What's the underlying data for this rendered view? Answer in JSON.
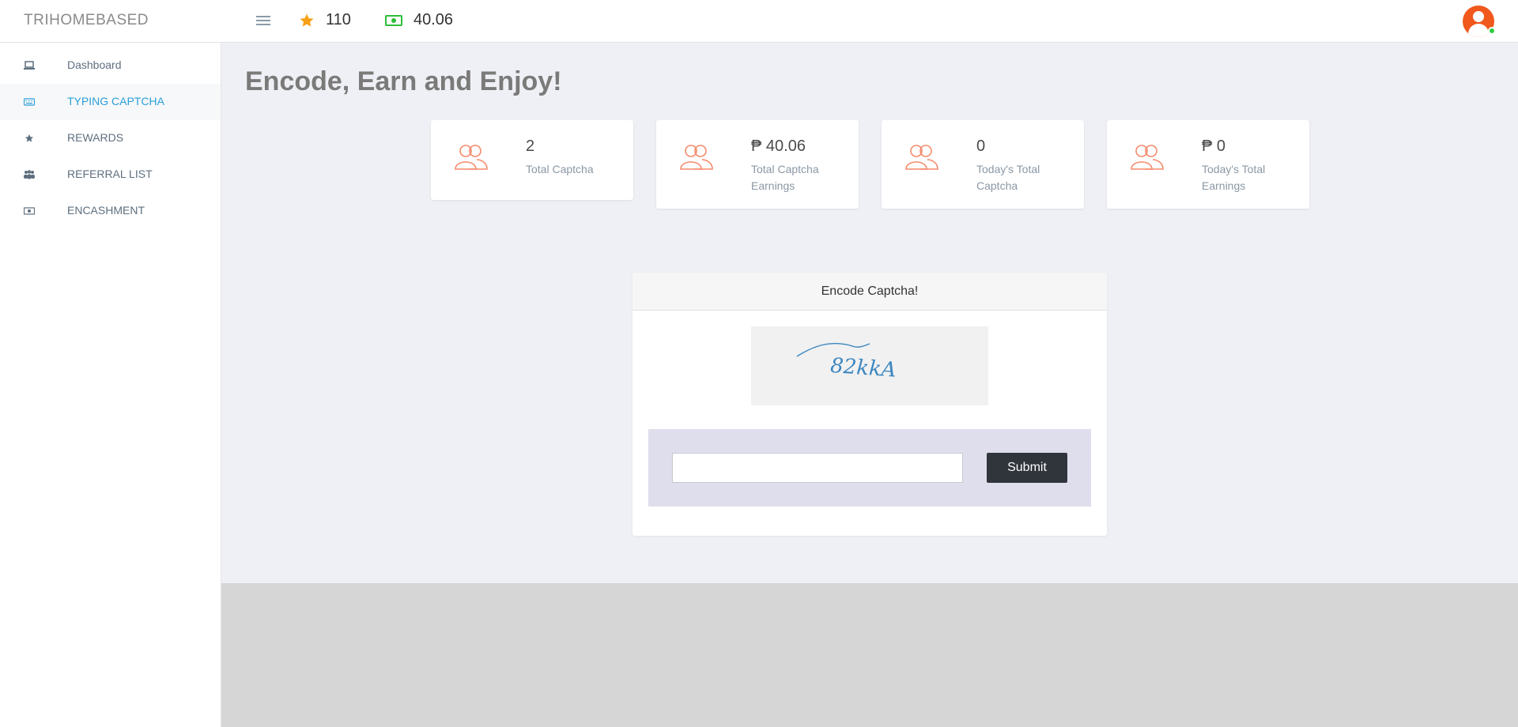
{
  "app": {
    "brand": "TRIHOMEBASED"
  },
  "header": {
    "points_value": "110",
    "balance_value": "40.06",
    "accent_star": "#f7a014",
    "accent_money": "#2ebd3a"
  },
  "sidebar": {
    "items": [
      {
        "label": "Dashboard",
        "icon": "laptop-icon"
      },
      {
        "label": "TYPING CAPTCHA",
        "icon": "keyboard-icon",
        "active": true
      },
      {
        "label": "REWARDS",
        "icon": "star-icon"
      },
      {
        "label": "REFERRAL LIST",
        "icon": "users-icon"
      },
      {
        "label": "ENCASHMENT",
        "icon": "money-icon"
      }
    ]
  },
  "main": {
    "title": "Encode, Earn and Enjoy!",
    "cards": [
      {
        "value": "2",
        "label": "Total Captcha"
      },
      {
        "value": "₱ 40.06",
        "label": "Total Captcha Earnings"
      },
      {
        "value": "0",
        "label": "Today's Total Captcha"
      },
      {
        "value": "₱ 0",
        "label": "Today's Total Earnings"
      }
    ],
    "captcha": {
      "heading": "Encode Captcha!",
      "image_text": "82kkA",
      "input_value": "",
      "submit_label": "Submit"
    }
  }
}
